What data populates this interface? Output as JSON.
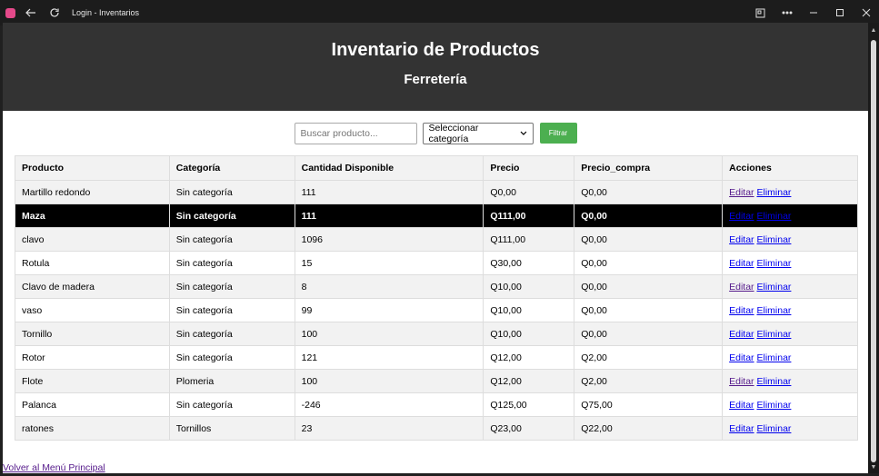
{
  "window": {
    "title": "Login - Inventarios"
  },
  "header": {
    "title": "Inventario de Productos",
    "subtitle": "Ferretería"
  },
  "filters": {
    "search_placeholder": "Buscar producto...",
    "category_selected": "Seleccionar categoría",
    "filter_button": "Filtrar"
  },
  "table": {
    "columns": [
      "Producto",
      "Categoría",
      "Cantidad Disponible",
      "Precio",
      "Precio_compra",
      "Acciones"
    ],
    "rows": [
      {
        "producto": "Martillo redondo",
        "categoria": "Sin categoría",
        "cantidad": "111",
        "precio": "Q0,00",
        "precio_compra": "Q0,00",
        "editar": "Editar",
        "eliminar": "Eliminar"
      },
      {
        "producto": "Maza",
        "categoria": "Sin categoría",
        "cantidad": "111",
        "precio": "Q111,00",
        "precio_compra": "Q0,00",
        "editar": "Editar",
        "eliminar": "Eliminar"
      },
      {
        "producto": "clavo",
        "categoria": "Sin categoría",
        "cantidad": "1096",
        "precio": "Q111,00",
        "precio_compra": "Q0,00",
        "editar": "Editar",
        "eliminar": "Eliminar"
      },
      {
        "producto": "Rotula",
        "categoria": "Sin categoría",
        "cantidad": "15",
        "precio": "Q30,00",
        "precio_compra": "Q0,00",
        "editar": "Editar",
        "eliminar": "Eliminar"
      },
      {
        "producto": "Clavo de madera",
        "categoria": "Sin categoría",
        "cantidad": "8",
        "precio": "Q10,00",
        "precio_compra": "Q0,00",
        "editar": "Editar",
        "eliminar": "Eliminar"
      },
      {
        "producto": "vaso",
        "categoria": "Sin categoría",
        "cantidad": "99",
        "precio": "Q10,00",
        "precio_compra": "Q0,00",
        "editar": "Editar",
        "eliminar": "Eliminar"
      },
      {
        "producto": "Tornillo",
        "categoria": "Sin categoría",
        "cantidad": "100",
        "precio": "Q10,00",
        "precio_compra": "Q0,00",
        "editar": "Editar",
        "eliminar": "Eliminar"
      },
      {
        "producto": "Rotor",
        "categoria": "Sin categoría",
        "cantidad": "121",
        "precio": "Q12,00",
        "precio_compra": "Q2,00",
        "editar": "Editar",
        "eliminar": "Eliminar"
      },
      {
        "producto": "Flote",
        "categoria": "Plomeria",
        "cantidad": "100",
        "precio": "Q12,00",
        "precio_compra": "Q2,00",
        "editar": "Editar",
        "eliminar": "Eliminar"
      },
      {
        "producto": "Palanca",
        "categoria": "Sin categoría",
        "cantidad": "-246",
        "precio": "Q125,00",
        "precio_compra": "Q75,00",
        "editar": "Editar",
        "eliminar": "Eliminar"
      },
      {
        "producto": "ratones",
        "categoria": "Tornillos",
        "cantidad": "23",
        "precio": "Q23,00",
        "precio_compra": "Q22,00",
        "editar": "Editar",
        "eliminar": "Eliminar"
      }
    ]
  },
  "footer": {
    "back_link": "Volver al Menú Principal"
  },
  "colors": {
    "header_bg": "#333333",
    "filter_button": "#4caf50",
    "selected_row": "#000000",
    "link": "#0000ee",
    "visited_link": "#551a8b"
  }
}
